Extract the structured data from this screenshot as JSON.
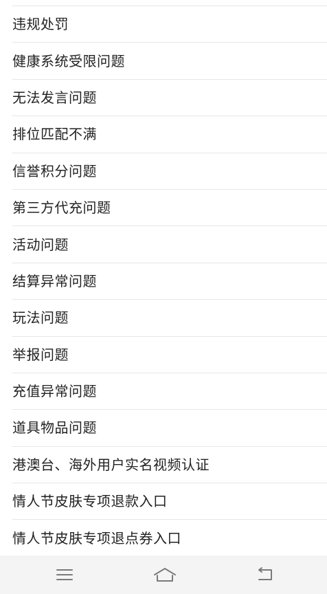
{
  "list": {
    "items": [
      {
        "label": "违规处罚"
      },
      {
        "label": "健康系统受限问题"
      },
      {
        "label": "无法发言问题"
      },
      {
        "label": "排位匹配不满"
      },
      {
        "label": "信誉积分问题"
      },
      {
        "label": "第三方代充问题"
      },
      {
        "label": "活动问题"
      },
      {
        "label": "结算异常问题"
      },
      {
        "label": "玩法问题"
      },
      {
        "label": "举报问题"
      },
      {
        "label": "充值异常问题"
      },
      {
        "label": "道具物品问题"
      },
      {
        "label": "港澳台、海外用户实名视频认证"
      },
      {
        "label": "情人节皮肤专项退款入口"
      },
      {
        "label": "情人节皮肤专项退点券入口"
      }
    ]
  },
  "navbar": {
    "icons": [
      "menu-icon",
      "home-icon",
      "back-icon"
    ],
    "icon_color": "#7a7a7a",
    "background": "#f4f4f4"
  }
}
